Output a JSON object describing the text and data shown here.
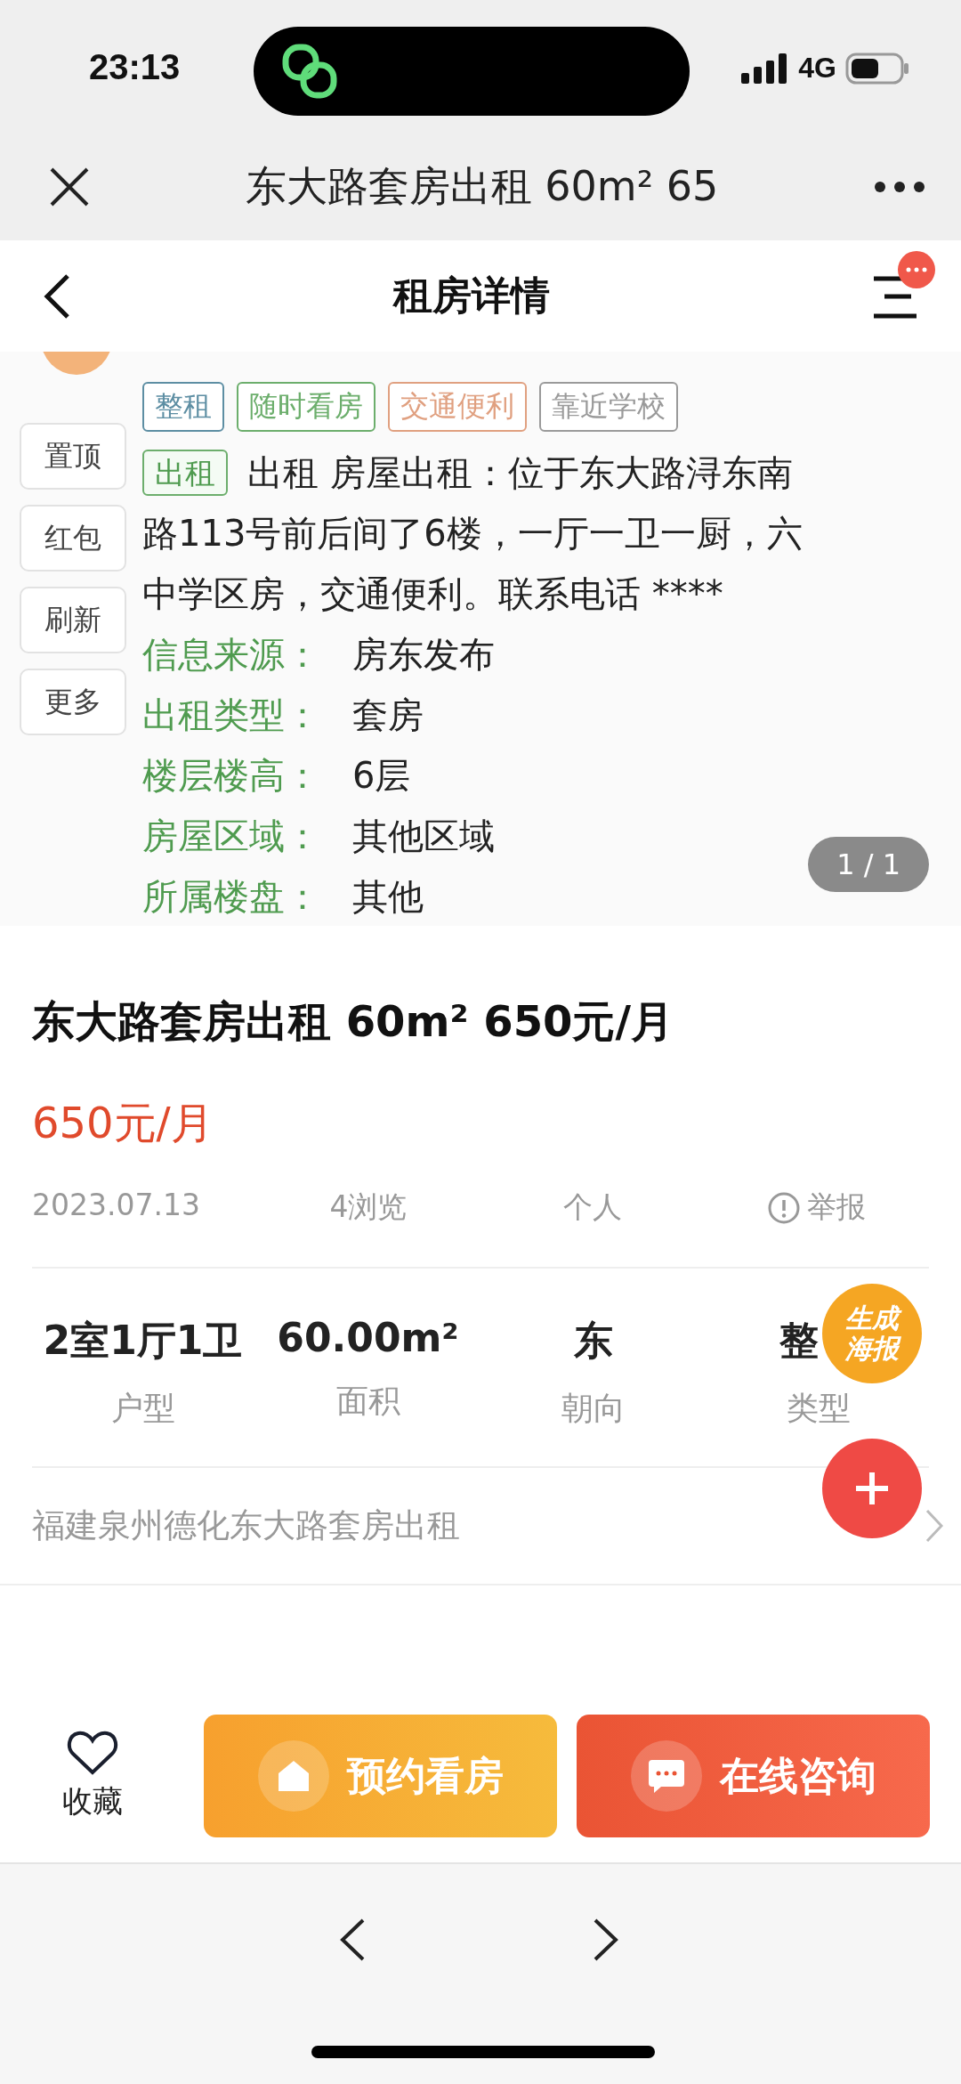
{
  "status_bar": {
    "time": "23:13",
    "network": "4G"
  },
  "browser_bar": {
    "title": "东大路套房出租 60m² 65"
  },
  "header": {
    "title": "租房详情"
  },
  "gallery": {
    "side_actions": [
      "置顶",
      "红包",
      "刷新",
      "更多"
    ],
    "tags": [
      {
        "label": "整租",
        "color": "#5d8ea3"
      },
      {
        "label": "随时看房",
        "color": "#6cae6c"
      },
      {
        "label": "交通便利",
        "color": "#e0a080"
      },
      {
        "label": "靠近学校",
        "color": "#9a9a9a"
      }
    ],
    "description": {
      "tag": "出租",
      "lines": [
        "出租 房屋出租：位于东大路浔东南",
        "路113号前后间了6楼，一厅一卫一厨，六",
        "中学区房，交通便利。联系电话 ****"
      ]
    },
    "details": [
      {
        "label": "信息来源：",
        "value": "房东发布"
      },
      {
        "label": "出租类型：",
        "value": "套房"
      },
      {
        "label": "楼层楼高：",
        "value": "6层"
      },
      {
        "label": "房屋区域：",
        "value": "其他区域"
      },
      {
        "label": "所属楼盘：",
        "value": "其他"
      }
    ],
    "counter": "1 / 1"
  },
  "listing": {
    "title": "东大路套房出租 60m² 650元/月",
    "price": "650元/月",
    "meta": {
      "date": "2023.07.13",
      "views": "4浏览",
      "publisher": "个人",
      "report": "举报"
    },
    "specs": [
      {
        "value": "2室1厅1卫",
        "label": "户型"
      },
      {
        "value": "60.00m²",
        "label": "面积"
      },
      {
        "value": "东",
        "label": "朝向"
      },
      {
        "value": "整",
        "label": "类型"
      }
    ],
    "location": "福建泉州德化东大路套房出租"
  },
  "floating": {
    "poster": [
      "生成",
      "海报"
    ]
  },
  "actions": {
    "favorite": "收藏",
    "buttons": [
      {
        "label": "预约看房",
        "kind": "visit"
      },
      {
        "label": "在线咨询",
        "kind": "chat"
      }
    ]
  }
}
